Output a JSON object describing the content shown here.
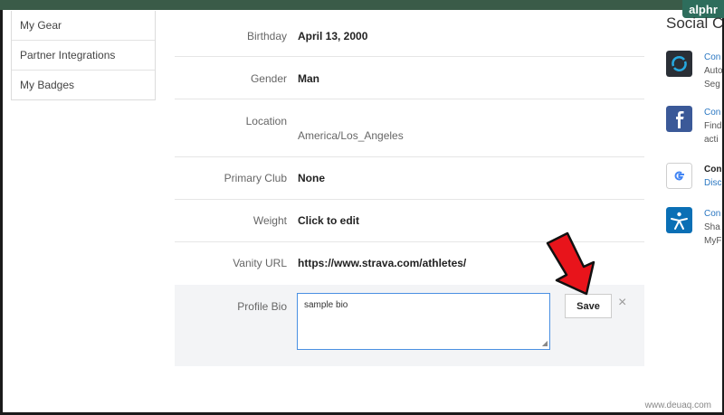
{
  "branding": {
    "badge": "alphr",
    "watermark": "www.deuaq.com"
  },
  "sidebar": {
    "items": [
      {
        "label": "My Gear"
      },
      {
        "label": "Partner Integrations"
      },
      {
        "label": "My Badges"
      }
    ]
  },
  "profile": {
    "birthday": {
      "label": "Birthday",
      "value": "April 13, 2000"
    },
    "gender": {
      "label": "Gender",
      "value": "Man"
    },
    "location": {
      "label": "Location",
      "value": "America/Los_Angeles"
    },
    "primary_club": {
      "label": "Primary Club",
      "value": "None"
    },
    "weight": {
      "label": "Weight",
      "value": "Click to edit"
    },
    "vanity_url": {
      "label": "Vanity URL",
      "value": "https://www.strava.com/athletes/"
    },
    "bio": {
      "label": "Profile Bio",
      "value": "sample bio",
      "save_label": "Save",
      "close_label": "×"
    }
  },
  "social": {
    "title": "Social C",
    "items": [
      {
        "icon": "garmin-connect-icon",
        "link": "Con",
        "desc": [
          "Auto",
          "Seg"
        ]
      },
      {
        "icon": "facebook-icon",
        "link": "Con",
        "desc": [
          "Find",
          "acti"
        ]
      },
      {
        "icon": "google-icon",
        "link": "Con",
        "desc_link": "Disc"
      },
      {
        "icon": "myfitnesspal-icon",
        "link": "Con",
        "desc": [
          "Sha",
          "MyF"
        ]
      }
    ]
  },
  "colors": {
    "accent_link": "#2a77c2",
    "textarea_border": "#4a90e2",
    "arrow": "#e8141b",
    "header_strip": "#3a5b48"
  }
}
